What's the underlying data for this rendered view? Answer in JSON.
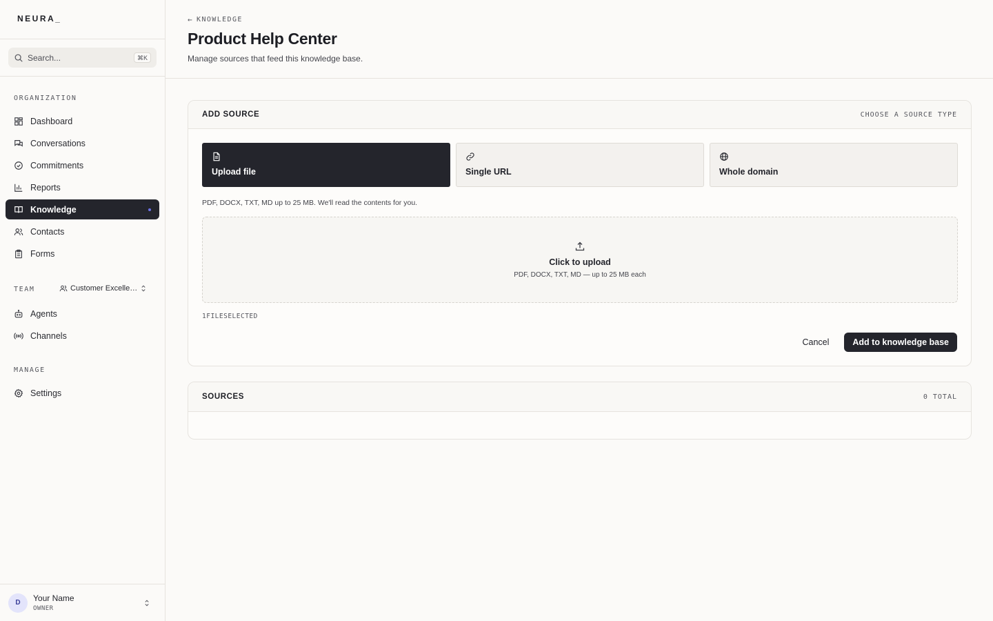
{
  "sidebar": {
    "logo": "NEURA_",
    "search": {
      "placeholder": "Search...",
      "shortcut": "⌘K"
    },
    "organization_label": "ORGANIZATION",
    "org_items": [
      {
        "label": "Dashboard",
        "icon": "dashboard-icon"
      },
      {
        "label": "Conversations",
        "icon": "conversations-icon"
      },
      {
        "label": "Commitments",
        "icon": "check-circle-icon"
      },
      {
        "label": "Reports",
        "icon": "bar-chart-icon"
      },
      {
        "label": "Knowledge",
        "icon": "book-icon",
        "active": true
      },
      {
        "label": "Contacts",
        "icon": "users-icon"
      },
      {
        "label": "Forms",
        "icon": "clipboard-icon"
      }
    ],
    "team_label": "TEAM",
    "team_name": "Customer Excellence",
    "team_items": [
      {
        "label": "Agents",
        "icon": "bot-icon"
      },
      {
        "label": "Channels",
        "icon": "broadcast-icon"
      }
    ],
    "manage_label": "MANAGE",
    "manage_items": [
      {
        "label": "Settings",
        "icon": "gear-icon"
      }
    ],
    "user": {
      "initial": "D",
      "name": "Your Name",
      "role": "OWNER"
    }
  },
  "header": {
    "breadcrumb": "KNOWLEDGE",
    "title": "Product Help Center",
    "subtitle": "Manage sources that feed this knowledge base."
  },
  "add_source": {
    "title": "ADD SOURCE",
    "meta": "CHOOSE A SOURCE TYPE",
    "types": [
      {
        "label": "Upload file",
        "icon": "file-icon",
        "active": true
      },
      {
        "label": "Single URL",
        "icon": "link-icon"
      },
      {
        "label": "Whole domain",
        "icon": "globe-icon"
      }
    ],
    "hint": "PDF, DOCX, TXT, MD up to 25 MB. We'll read the contents for you.",
    "dropzone_title": "Click to upload",
    "dropzone_sub": "PDF, DOCX, TXT, MD — up to 25 MB each",
    "files_selected": "1FILESELECTED",
    "cancel_label": "Cancel",
    "submit_label": "Add to knowledge base"
  },
  "sources": {
    "title": "SOURCES",
    "total": "0 TOTAL"
  },
  "colors": {
    "accent_dark": "#24252c",
    "active_dot": "#6d72e8",
    "background": "#fbfaf8"
  }
}
